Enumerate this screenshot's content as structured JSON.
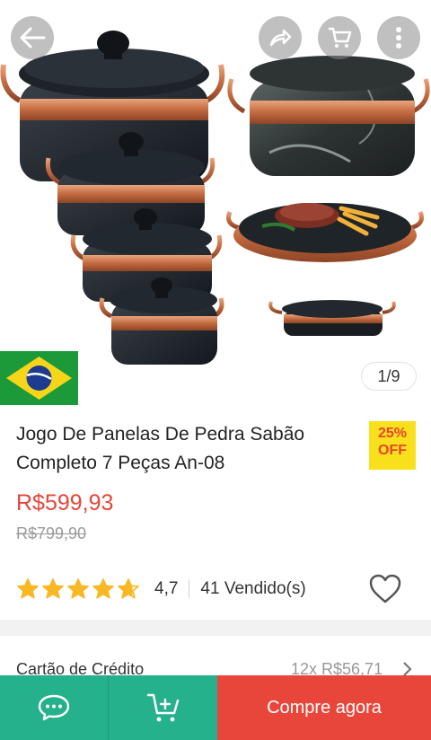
{
  "gallery": {
    "counter": "1/9",
    "icons": {
      "back": "arrow-left-icon",
      "share": "share-icon",
      "cart": "cart-icon",
      "more": "more-vertical-icon",
      "flag": "brazil-flag-icon"
    }
  },
  "product": {
    "title": "Jogo De Panelas De Pedra Sabão Completo 7 Peças An-08",
    "discount": {
      "percent": "25%",
      "label": "OFF"
    },
    "price": "R$599,93",
    "old_price": "R$799,90",
    "rating": {
      "stars": 4.7,
      "value": "4,7"
    },
    "sold": "41 Vendido(s)"
  },
  "payment": {
    "label": "Cartão de Crédito",
    "value": "12x R$56,71"
  },
  "bottom_bar": {
    "buy_label": "Compre agora"
  },
  "colors": {
    "price": "#e8443a",
    "discount_bg": "#f8e11c",
    "bar_green": "#26b18d",
    "buy_red": "#e8463b",
    "star": "#f7b824"
  }
}
